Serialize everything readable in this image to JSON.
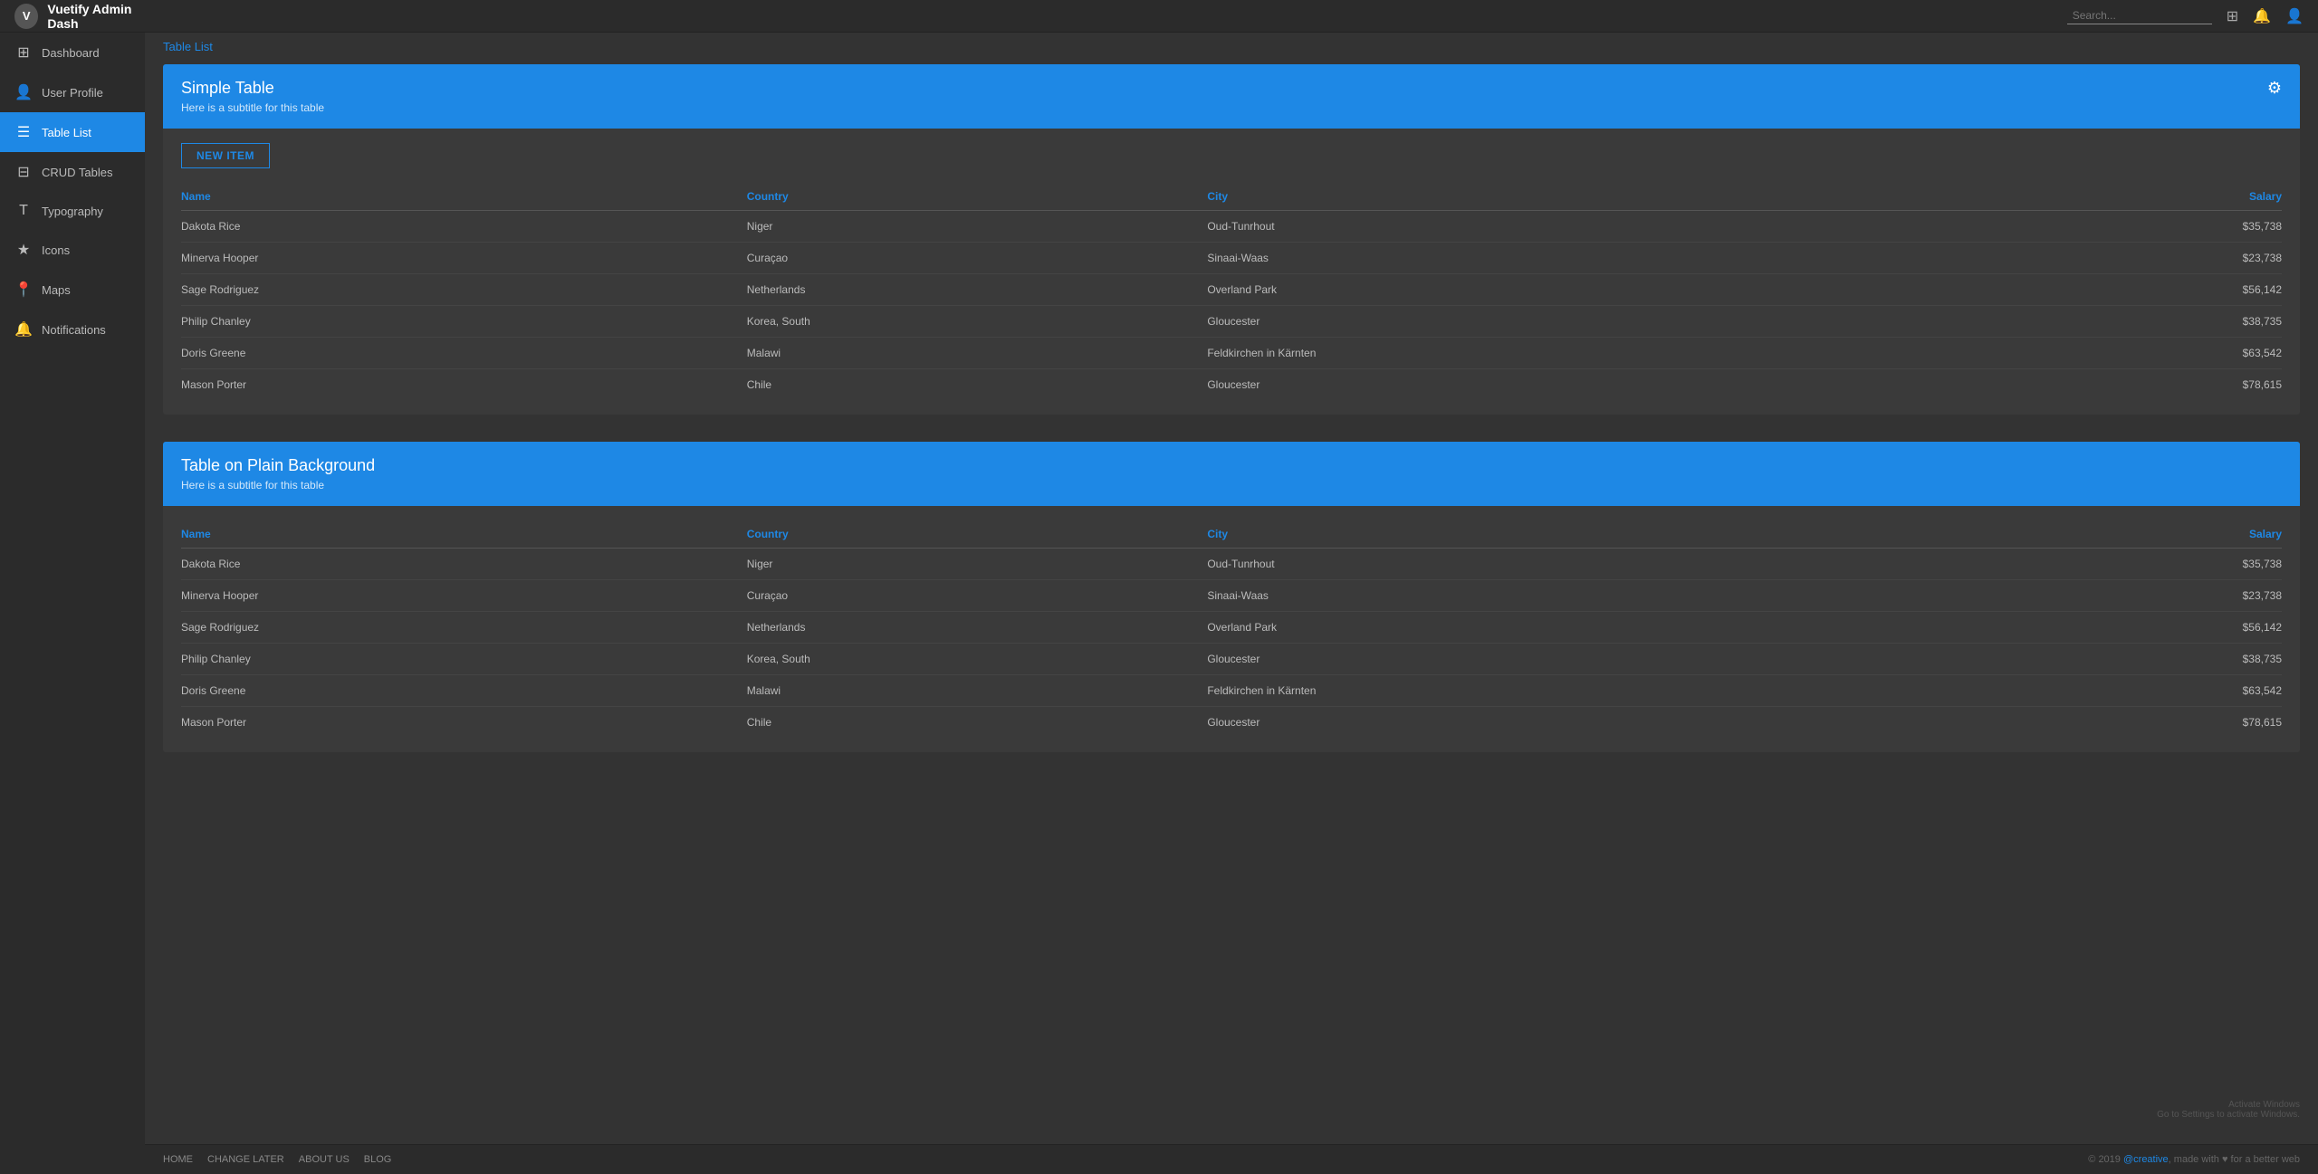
{
  "brand": {
    "name": "Vuetify Admin Dash",
    "avatar_initial": "V"
  },
  "topbar": {
    "search_placeholder": "Search...",
    "icons": [
      "grid-icon",
      "bell-icon",
      "user-icon"
    ]
  },
  "sidebar": {
    "items": [
      {
        "id": "dashboard",
        "label": "Dashboard",
        "icon": "⊞",
        "active": false
      },
      {
        "id": "user-profile",
        "label": "User Profile",
        "icon": "👤",
        "active": false
      },
      {
        "id": "table-list",
        "label": "Table List",
        "icon": "⊟",
        "active": true
      },
      {
        "id": "crud-tables",
        "label": "CRUD Tables",
        "icon": "☰",
        "active": false
      },
      {
        "id": "typography",
        "label": "Typography",
        "icon": "T",
        "active": false
      },
      {
        "id": "icons",
        "label": "Icons",
        "icon": "★",
        "active": false
      },
      {
        "id": "maps",
        "label": "Maps",
        "icon": "📍",
        "active": false
      },
      {
        "id": "notifications",
        "label": "Notifications",
        "icon": "🔔",
        "active": false
      }
    ]
  },
  "page": {
    "breadcrumb": "Table List"
  },
  "tables": [
    {
      "id": "simple-table",
      "title": "Simple Table",
      "subtitle": "Here is a subtitle for this table",
      "show_new_button": true,
      "new_button_label": "NEW ITEM",
      "columns": [
        {
          "key": "name",
          "label": "Name",
          "align": "left"
        },
        {
          "key": "country",
          "label": "Country",
          "align": "left"
        },
        {
          "key": "city",
          "label": "City",
          "align": "left"
        },
        {
          "key": "salary",
          "label": "Salary",
          "align": "right"
        }
      ],
      "rows": [
        {
          "name": "Dakota Rice",
          "country": "Niger",
          "city": "Oud-Tunrhout",
          "salary": "$35,738"
        },
        {
          "name": "Minerva Hooper",
          "country": "Curaçao",
          "city": "Sinaai-Waas",
          "salary": "$23,738"
        },
        {
          "name": "Sage Rodriguez",
          "country": "Netherlands",
          "city": "Overland Park",
          "salary": "$56,142"
        },
        {
          "name": "Philip Chanley",
          "country": "Korea, South",
          "city": "Gloucester",
          "salary": "$38,735"
        },
        {
          "name": "Doris Greene",
          "country": "Malawi",
          "city": "Feldkirchen in Kärnten",
          "salary": "$63,542"
        },
        {
          "name": "Mason Porter",
          "country": "Chile",
          "city": "Gloucester",
          "salary": "$78,615"
        }
      ]
    },
    {
      "id": "plain-table",
      "title": "Table on Plain Background",
      "subtitle": "Here is a subtitle for this table",
      "show_new_button": false,
      "columns": [
        {
          "key": "name",
          "label": "Name",
          "align": "left"
        },
        {
          "key": "country",
          "label": "Country",
          "align": "left"
        },
        {
          "key": "city",
          "label": "City",
          "align": "left"
        },
        {
          "key": "salary",
          "label": "Salary",
          "align": "right"
        }
      ],
      "rows": [
        {
          "name": "Dakota Rice",
          "country": "Niger",
          "city": "Oud-Tunrhout",
          "salary": "$35,738"
        },
        {
          "name": "Minerva Hooper",
          "country": "Curaçao",
          "city": "Sinaai-Waas",
          "salary": "$23,738"
        },
        {
          "name": "Sage Rodriguez",
          "country": "Netherlands",
          "city": "Overland Park",
          "salary": "$56,142"
        },
        {
          "name": "Philip Chanley",
          "country": "Korea, South",
          "city": "Gloucester",
          "salary": "$38,735"
        },
        {
          "name": "Doris Greene",
          "country": "Malawi",
          "city": "Feldkirchen in Kärnten",
          "salary": "$63,542"
        },
        {
          "name": "Mason Porter",
          "country": "Chile",
          "city": "Gloucester",
          "salary": "$78,615"
        }
      ]
    }
  ],
  "footer": {
    "links": [
      "HOME",
      "CHANGE LATER",
      "ABOUT US",
      "BLOG"
    ],
    "copyright": "© 2019 ",
    "brand_link": "@creative",
    "copyright_suffix": ", made with ♥ for a better web"
  },
  "activate_windows": {
    "line1": "Activate Windows",
    "line2": "Go to Settings to activate Windows."
  }
}
